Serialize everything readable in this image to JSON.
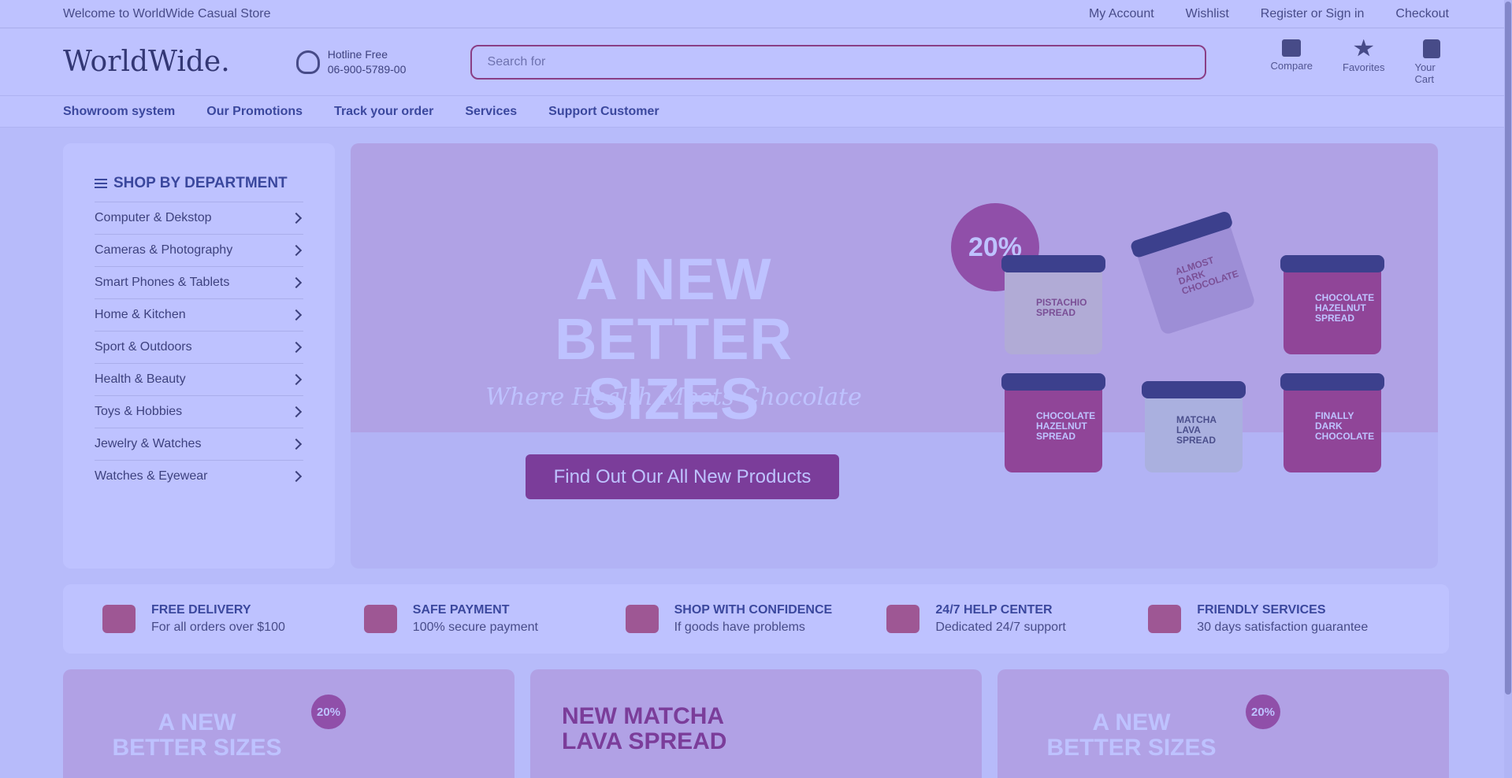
{
  "topbar": {
    "welcome": "Welcome to WorldWide Casual Store",
    "links": [
      "My Account",
      "Wishlist",
      "Register or Sign in",
      "Checkout"
    ]
  },
  "header": {
    "logo": "WorldWide.",
    "hotline_label": "Hotline Free",
    "hotline_number": "06-900-5789-00",
    "search_placeholder": "Search for",
    "icons": [
      {
        "label": "Compare",
        "icon": "compare-icon"
      },
      {
        "label": "Favorites",
        "icon": "star-icon"
      },
      {
        "label": "Your Cart",
        "icon": "bag-icon"
      }
    ]
  },
  "nav": [
    "Showroom system",
    "Our Promotions",
    "Track your order",
    "Services",
    "Support Customer"
  ],
  "department": {
    "title": "SHOP BY DEPARTMENT",
    "items": [
      "Computer & Dekstop",
      "Cameras & Photography",
      "Smart Phones & Tablets",
      "Home & Kitchen",
      "Sport & Outdoors",
      "Health & Beauty",
      "Toys & Hobbies",
      "Jewelry & Watches",
      "Watches & Eyewear"
    ]
  },
  "hero": {
    "title_line1": "A NEW",
    "title_line2": "BETTER SIZES",
    "subtitle": "Where Health Meets Chocolate",
    "button": "Find Out Our All New Products",
    "badge": "20%",
    "jars": [
      "PISTACHIO SPREAD",
      "ALMOST DARK CHOCOLATE",
      "CHOCOLATE HAZELNUT SPREAD",
      "CHOCOLATE HAZELNUT SPREAD",
      "MATCHA LAVA SPREAD",
      "FINALLY DARK CHOCOLATE"
    ]
  },
  "features": [
    {
      "title": "FREE DELIVERY",
      "sub": "For all orders over $100",
      "icon": "truck-icon"
    },
    {
      "title": "SAFE PAYMENT",
      "sub": "100% secure payment",
      "icon": "card-icon"
    },
    {
      "title": "SHOP WITH CONFIDENCE",
      "sub": "If goods have problems",
      "icon": "hand-dollar-icon"
    },
    {
      "title": "24/7 HELP CENTER",
      "sub": "Dedicated 24/7 support",
      "icon": "chat-icon"
    },
    {
      "title": "FRIENDLY SERVICES",
      "sub": "30 days satisfaction guarantee",
      "icon": "services-icon"
    }
  ],
  "promos": [
    {
      "title": "A NEW BETTER SIZES",
      "badge": "20%"
    },
    {
      "title": "NEW MATCHA LAVA SPREAD",
      "badge": ""
    },
    {
      "title": "A NEW BETTER SIZES",
      "badge": "20%"
    }
  ]
}
